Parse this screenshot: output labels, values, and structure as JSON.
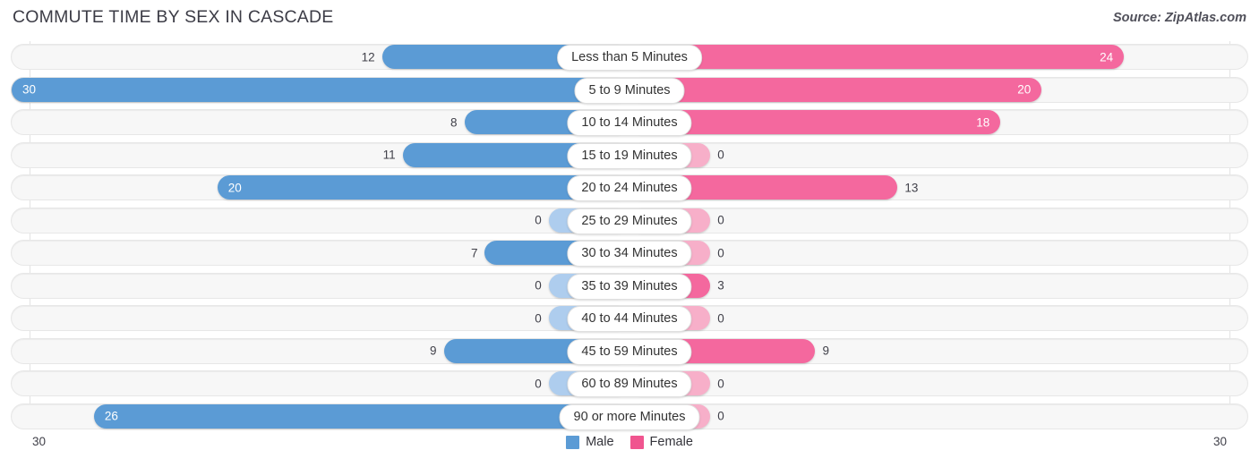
{
  "header": {
    "title": "COMMUTE TIME BY SEX IN CASCADE",
    "source": "Source: ZipAtlas.com"
  },
  "axis": {
    "left_label": "30",
    "right_label": "30"
  },
  "legend": {
    "items": [
      {
        "label": "Male",
        "color": "#5b9bd5"
      },
      {
        "label": "Female",
        "color": "#f0558f"
      }
    ]
  },
  "colors": {
    "male_strong": "#5b9bd5",
    "male_light": "#aecdee",
    "female_strong": "#f4689e",
    "female_light": "#f7afc9",
    "track": "#f7f7f7",
    "track_border": "#e7e7e7"
  },
  "chart_data": {
    "type": "bar",
    "title": "COMMUTE TIME BY SEX IN CASCADE",
    "subtitle": "Source: ZipAtlas.com",
    "orientation": "horizontal-diverging",
    "xlabel": "",
    "ylabel": "",
    "axis_max": 30,
    "xlim": [
      -30,
      30
    ],
    "grid": true,
    "legend_position": "bottom-center",
    "categories": [
      "Less than 5 Minutes",
      "5 to 9 Minutes",
      "10 to 14 Minutes",
      "15 to 19 Minutes",
      "20 to 24 Minutes",
      "25 to 29 Minutes",
      "30 to 34 Minutes",
      "35 to 39 Minutes",
      "40 to 44 Minutes",
      "45 to 59 Minutes",
      "60 to 89 Minutes",
      "90 or more Minutes"
    ],
    "series": [
      {
        "name": "Male",
        "side": "left",
        "color": "#5b9bd5",
        "values": [
          12,
          30,
          8,
          11,
          20,
          0,
          7,
          0,
          0,
          9,
          0,
          26
        ]
      },
      {
        "name": "Female",
        "side": "right",
        "color": "#f4689e",
        "values": [
          24,
          20,
          18,
          0,
          13,
          0,
          0,
          3,
          0,
          9,
          0,
          0
        ]
      }
    ]
  }
}
